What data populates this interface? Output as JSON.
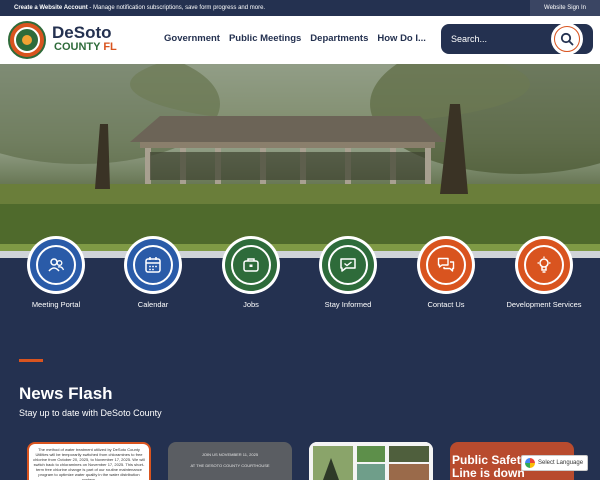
{
  "topbar": {
    "message_bold": "Create a Website Account",
    "message_rest": " - Manage notification subscriptions, save form progress and more.",
    "signin_label": "Website Sign In"
  },
  "header": {
    "brand_name": "DeSoto",
    "brand_county": "COUNTY",
    "brand_state": "FL",
    "nav": [
      "Government",
      "Public Meetings",
      "Departments",
      "How Do I..."
    ],
    "search_placeholder": "Search..."
  },
  "quick_links": [
    {
      "label": "Meeting Portal",
      "icon": "people-icon",
      "color": "#2a5ba8"
    },
    {
      "label": "Calendar",
      "icon": "calendar-icon",
      "color": "#2a5ba8"
    },
    {
      "label": "Jobs",
      "icon": "briefcase-icon",
      "color": "#2e6b3a"
    },
    {
      "label": "Stay Informed",
      "icon": "message-icon",
      "color": "#2e6b3a"
    },
    {
      "label": "Contact Us",
      "icon": "chat-icon",
      "color": "#d9541f"
    },
    {
      "label": "Development Services",
      "icon": "settings-bulb-icon",
      "color": "#d9541f"
    }
  ],
  "news": {
    "title": "News Flash",
    "subtitle": "Stay up to date with DeSoto County",
    "card1_text": "The method of water treatment utilized by DeSoto County Utilities will be temporarily switched from chloramines to free chlorine from October 20, 2025, to November 17, 2025. We will switch back to chloramines on November 17, 2025. This short-term free chlorine change is part of our routine maintenance program to optimize water quality in the water distribution system.",
    "card2_line1": "JOIN US NOVEMBER 11, 2025",
    "card2_line2": "AT THE DESOTO COUNTY COURTHOUSE",
    "card4_text": "Public Safety Phone Line is down"
  },
  "translate_label": "Select Language",
  "colors": {
    "navy": "#243150",
    "orange": "#d9541f",
    "green": "#2e6b3a",
    "blue": "#2a5ba8"
  }
}
